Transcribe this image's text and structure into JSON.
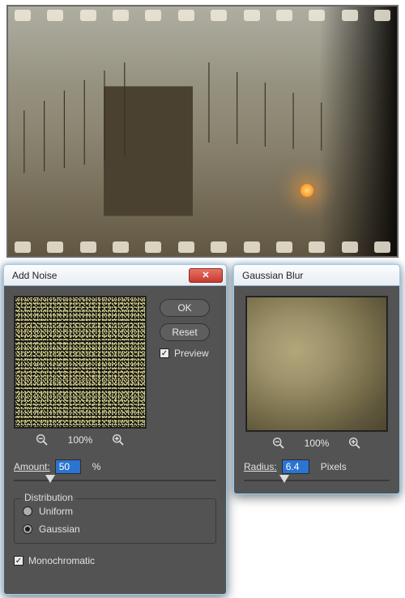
{
  "dialogs": {
    "addNoise": {
      "title": "Add Noise",
      "buttons": {
        "ok": "OK",
        "reset": "Reset"
      },
      "preview_label": "Preview",
      "preview_checked": true,
      "zoom_percent": "100%",
      "amount": {
        "label": "Amount:",
        "value": "50",
        "unit": "%",
        "slider_pos_pct": 18
      },
      "distribution": {
        "legend": "Distribution",
        "options": {
          "uniform": "Uniform",
          "gaussian": "Gaussian"
        },
        "selected": "gaussian"
      },
      "monochromatic": {
        "label": "Monochromatic",
        "checked": true
      }
    },
    "gaussianBlur": {
      "title": "Gaussian Blur",
      "zoom_percent": "100%",
      "radius": {
        "label": "Radius:",
        "value": "6.4",
        "unit": "Pixels",
        "slider_pos_pct": 28
      }
    }
  },
  "icons": {
    "close_glyph": "✕",
    "check_glyph": "✓"
  }
}
